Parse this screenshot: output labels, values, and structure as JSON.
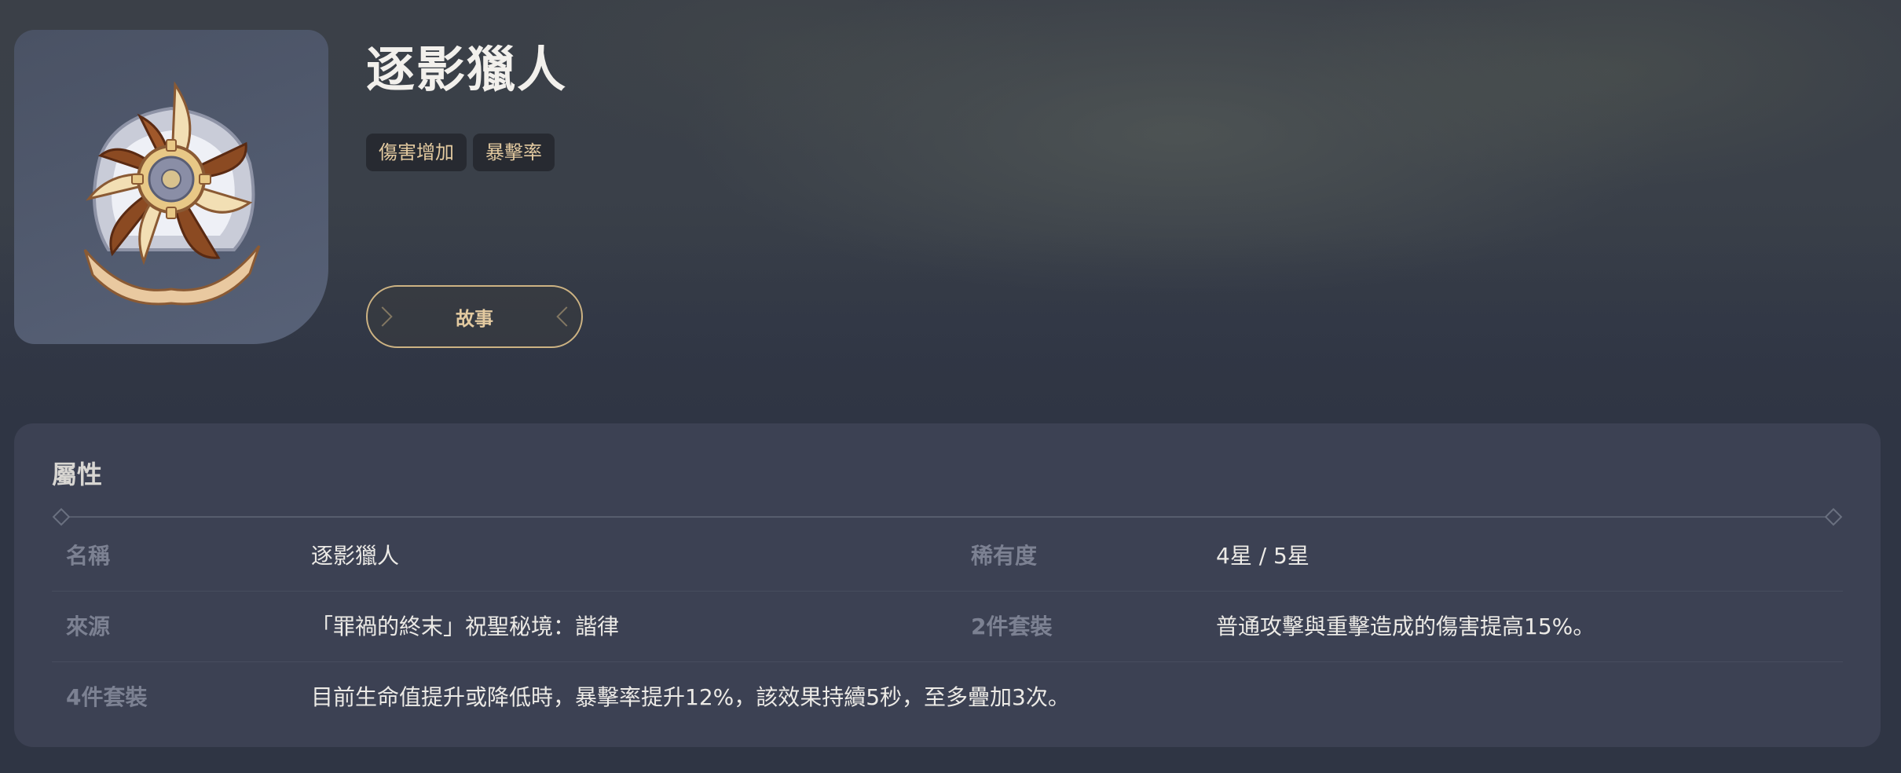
{
  "artifact": {
    "name": "逐影獵人",
    "tags": [
      "傷害增加",
      "暴擊率"
    ],
    "story_button": "故事",
    "icon": "artifact-flower-icon"
  },
  "attributes": {
    "heading": "屬性",
    "rows": [
      {
        "left_label": "名稱",
        "left_value": "逐影獵人",
        "right_label": "稀有度",
        "right_value": "4星 / 5星"
      },
      {
        "left_label": "來源",
        "left_value": "「罪禍的終末」祝聖秘境：諧律",
        "right_label": "2件套裝",
        "right_value": "普通攻擊與重擊造成的傷害提高15%。"
      },
      {
        "left_label": "4件套裝",
        "left_value": "目前生命值提升或降低時，暴擊率提升12%，該效果持續5秒，至多疊加3次。"
      }
    ]
  },
  "colors": {
    "background": "#2f3544",
    "panel": "#3c4153",
    "accent_gold": "#e3caa0",
    "label_gray": "#7c8192"
  }
}
